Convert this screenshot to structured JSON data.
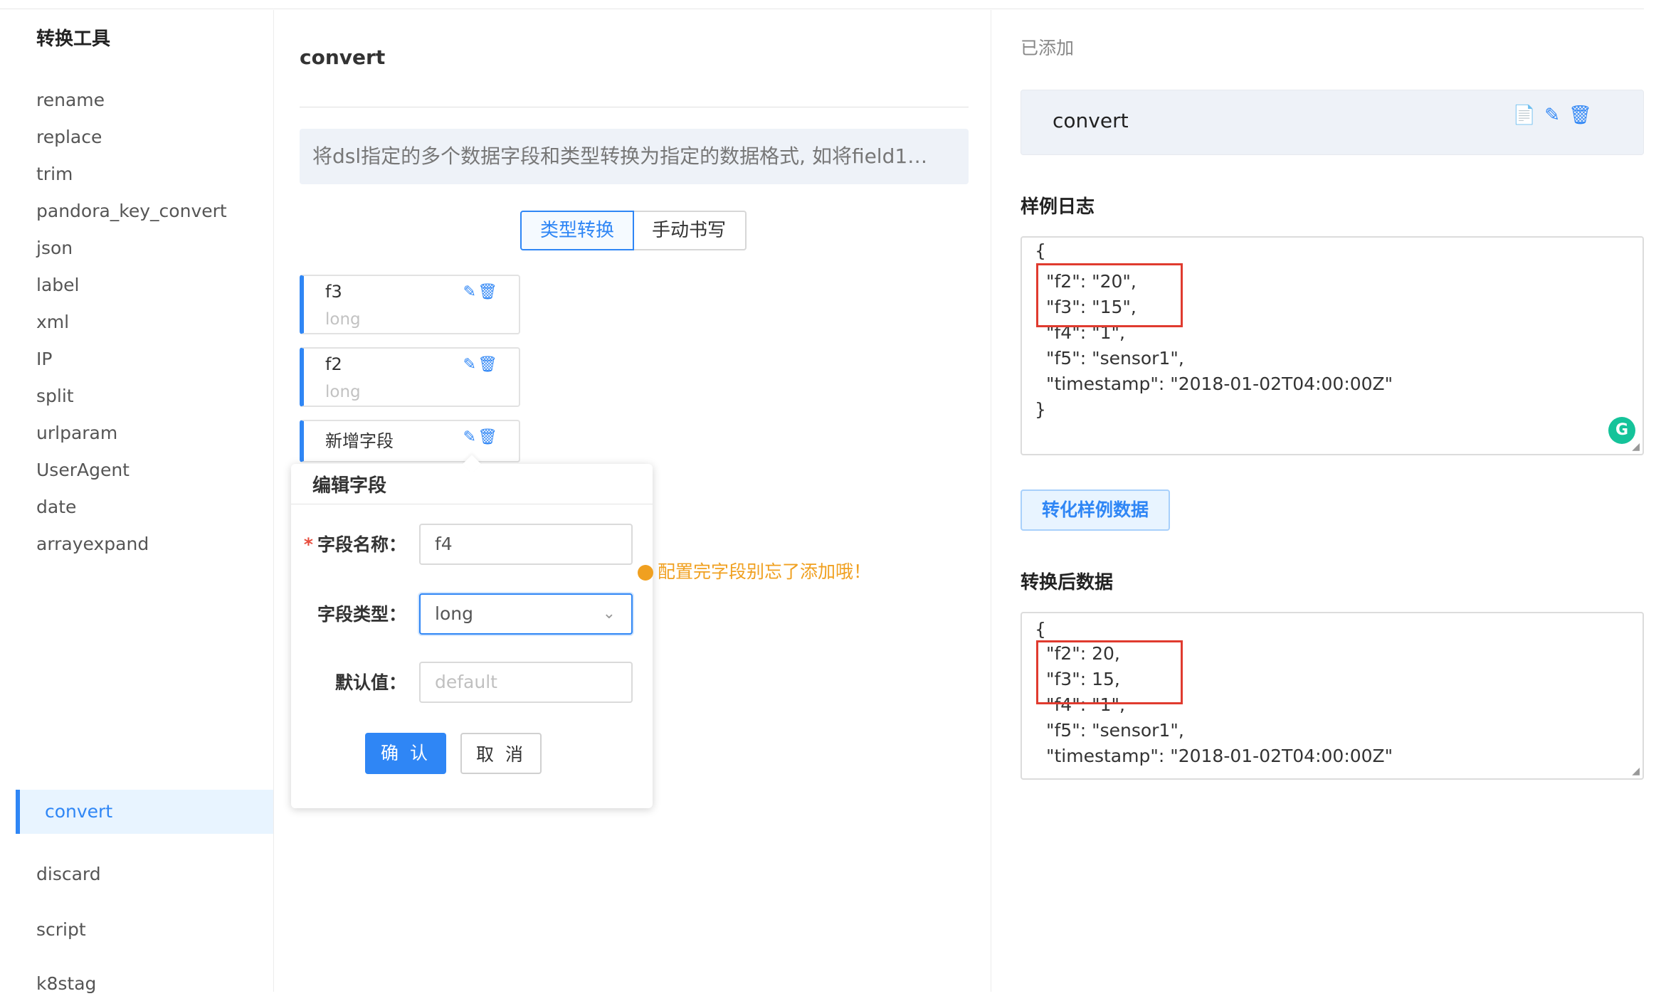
{
  "sidebar": {
    "title": "转换工具",
    "items": [
      {
        "label": "rename"
      },
      {
        "label": "replace"
      },
      {
        "label": "trim"
      },
      {
        "label": "pandora_key_convert"
      },
      {
        "label": "json"
      },
      {
        "label": "label"
      },
      {
        "label": "xml"
      },
      {
        "label": "IP"
      },
      {
        "label": "split"
      },
      {
        "label": "urlparam"
      },
      {
        "label": "UserAgent"
      },
      {
        "label": "date"
      },
      {
        "label": "arrayexpand"
      },
      {
        "label": "convert"
      },
      {
        "label": "discard"
      },
      {
        "label": "script"
      },
      {
        "label": "k8stag"
      }
    ],
    "active": "convert"
  },
  "main": {
    "title": "convert",
    "description": "将dsl指定的多个数据字段和类型转换为指定的数据格式, 如将field1…",
    "tabs": [
      {
        "label": "类型转换"
      },
      {
        "label": "手动书写"
      }
    ],
    "fields": [
      {
        "name": "f3",
        "type": "long"
      },
      {
        "name": "f2",
        "type": "long"
      },
      {
        "name": "新增字段",
        "type": ""
      }
    ],
    "edit_popover": {
      "title": "编辑字段",
      "name_label": "字段名称：",
      "name_value": "f4",
      "type_label": "字段类型：",
      "type_value": "long",
      "default_label": "默认值：",
      "default_placeholder": "default",
      "confirm": "确 认",
      "cancel": "取 消"
    },
    "warning": "配置完字段别忘了添加哦！"
  },
  "right": {
    "added_label": "已添加",
    "added_item": "convert",
    "sample_title": "样例日志",
    "sample_lines": [
      "{",
      "\"f2\": \"20\",",
      "\"f3\": \"15\",",
      "\"f4\": \"1\",",
      "\"f5\": \"sensor1\",",
      "\"timestamp\": \"2018-01-02T04:00:00Z\"",
      "}"
    ],
    "convert_button": "转化样例数据",
    "result_title": "转换后数据",
    "result_lines": [
      "{",
      "\"f2\": 20,",
      "\"f3\": 15,",
      "\"f4\": \"1\",",
      "\"f5\": \"sensor1\",",
      "\"timestamp\": \"2018-01-02T04:00:00Z\""
    ]
  },
  "colors": {
    "accent": "#2f86f5",
    "warning": "#f0a020",
    "highlight": "#e03b2f"
  },
  "icons": [
    "edit-icon",
    "delete-icon",
    "copy-icon",
    "chevron-down-icon",
    "grammarly-icon",
    "warning-icon"
  ]
}
